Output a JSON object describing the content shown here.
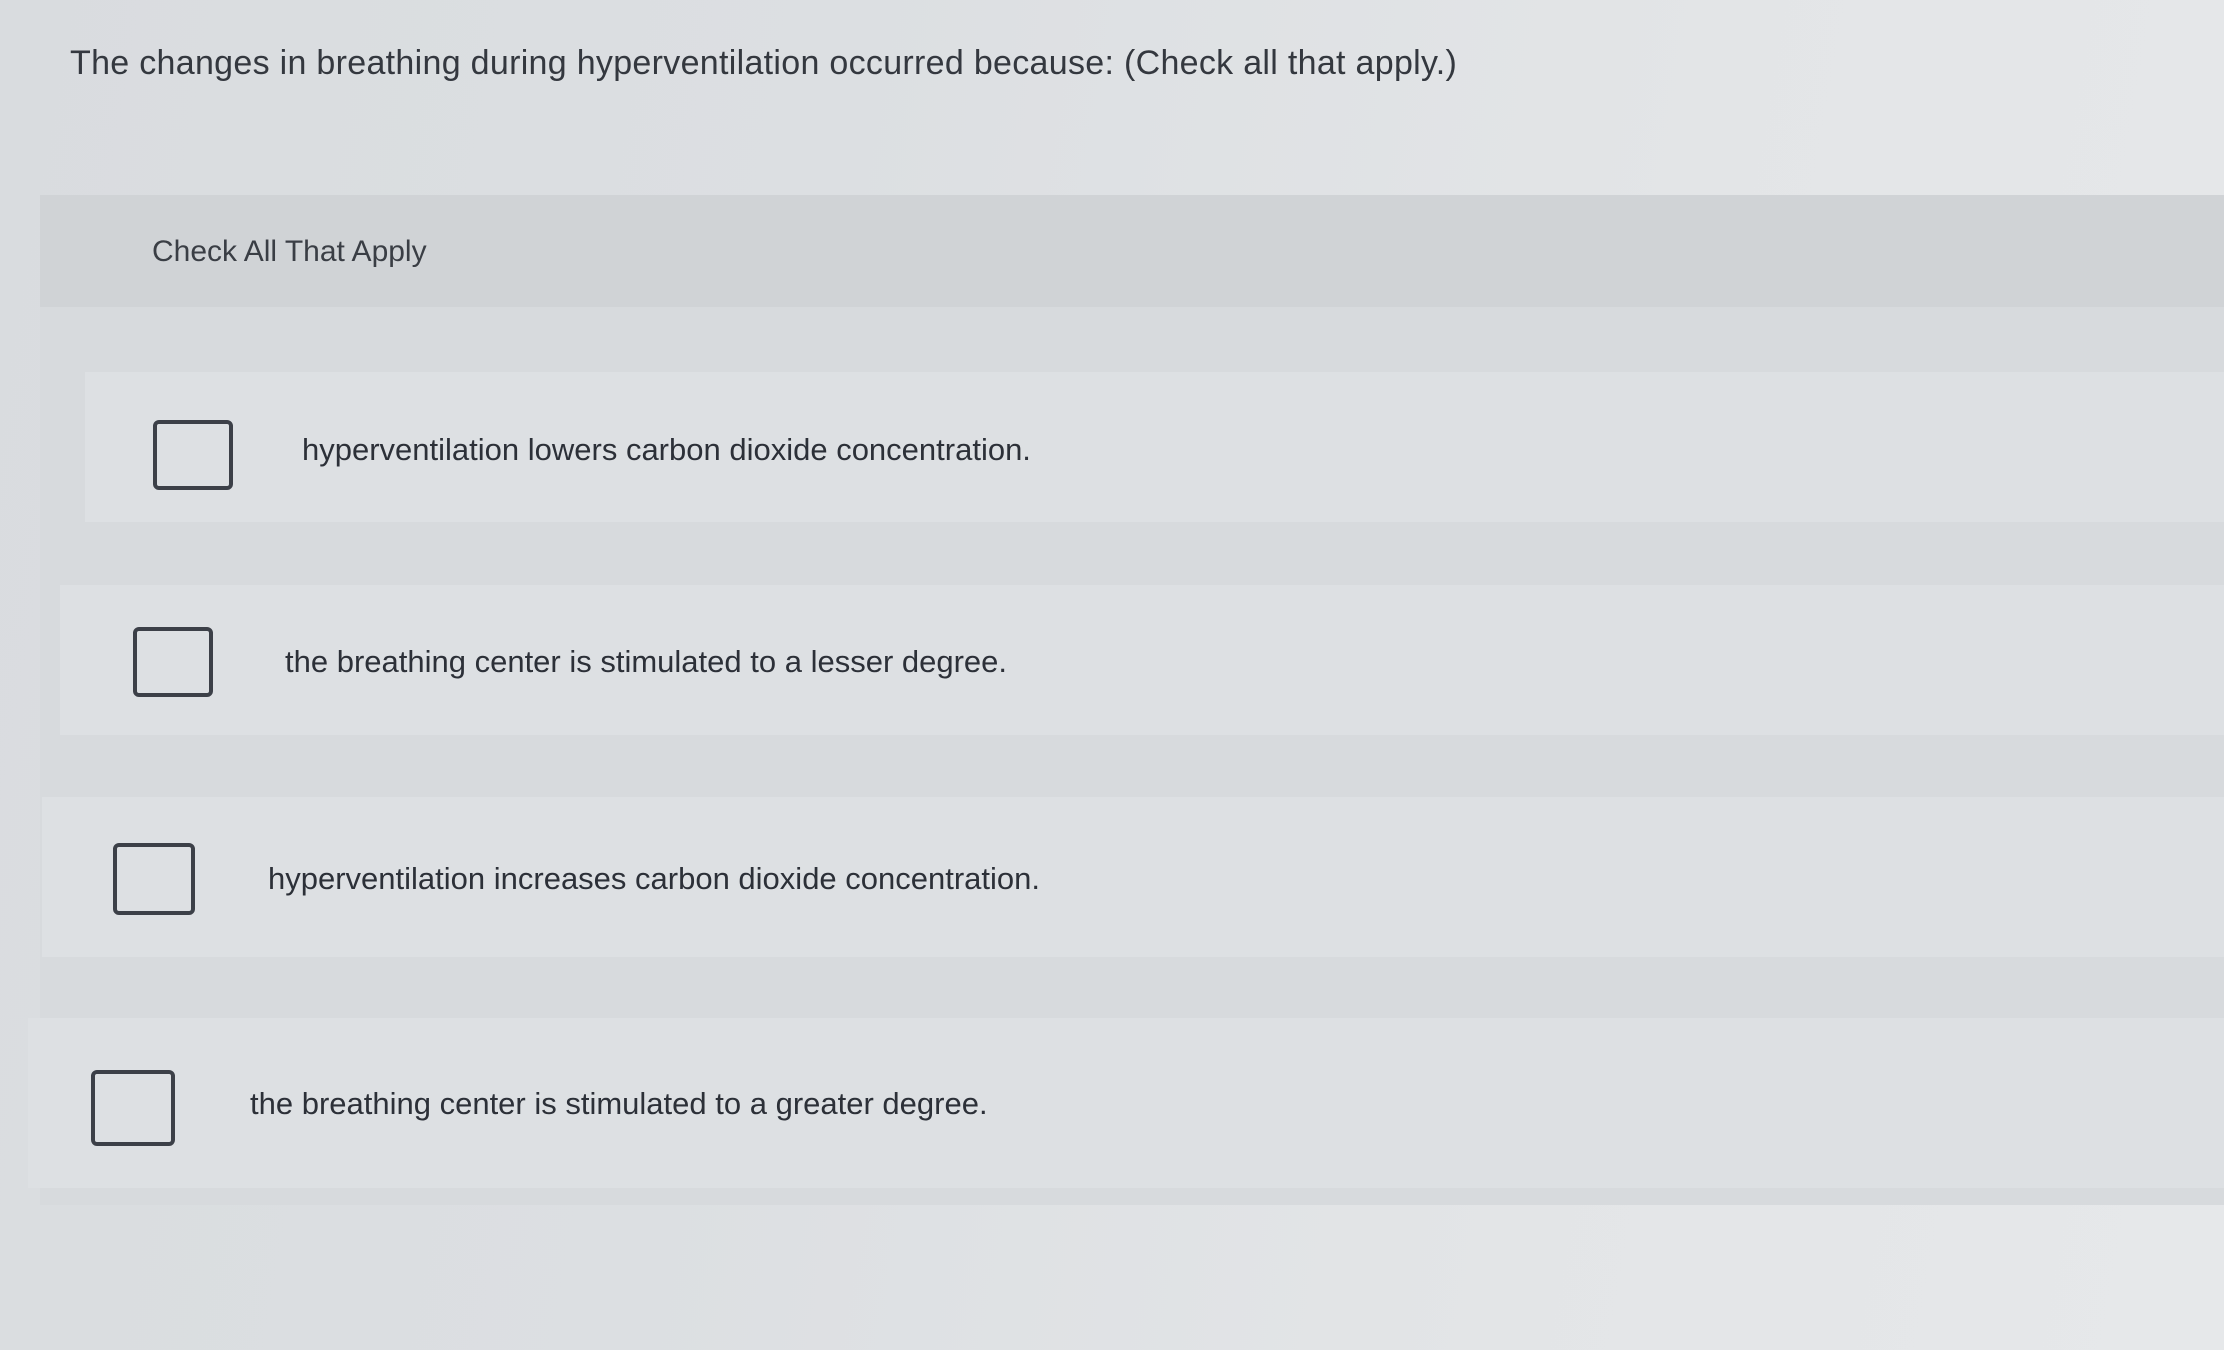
{
  "question": {
    "text": "The changes in breathing during hyperventilation occurred because:  (Check all that apply.)"
  },
  "panel": {
    "header_label": "Check All That Apply"
  },
  "options": [
    {
      "label": "hyperventilation lowers carbon dioxide concentration.",
      "checked": false
    },
    {
      "label": "the breathing center is stimulated to a lesser degree.",
      "checked": false
    },
    {
      "label": "hyperventilation increases carbon dioxide concentration.",
      "checked": false
    },
    {
      "label": "the breathing center is stimulated to a greater degree.",
      "checked": false
    }
  ]
}
